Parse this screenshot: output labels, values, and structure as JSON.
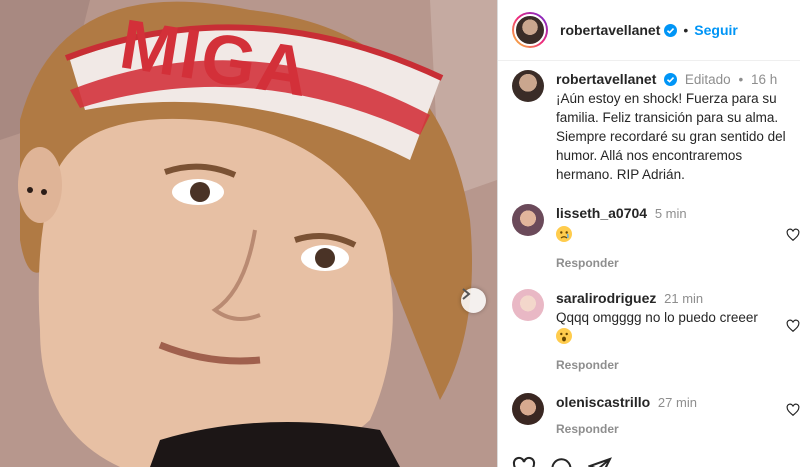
{
  "header": {
    "username": "robertavellanet",
    "follow_label": "Seguir",
    "separator": "•"
  },
  "caption": {
    "username": "robertavellanet",
    "edited": "Editado",
    "separator": "•",
    "time": "16 h",
    "text": "¡Aún estoy en shock! Fuerza para su familia. Feliz transición para su alma. Siempre recordaré su gran sentido del humor. Allá nos encontraremos hermano. RIP Adrián."
  },
  "photo": {
    "headband_text": "MIGA"
  },
  "comments": [
    {
      "username": "lisseth_a0704",
      "time": "5 min",
      "text": "",
      "emoji": "sad-face",
      "reply_label": "Responder"
    },
    {
      "username": "saralirodriguez",
      "time": "21 min",
      "text": "Qqqq omgggg no lo puedo creeer",
      "emoji": "surprised-face",
      "reply_label": "Responder"
    },
    {
      "username": "oleniscastrillo",
      "time": "27 min",
      "text": "",
      "emoji": "",
      "reply_label": "Responder"
    }
  ],
  "colors": {
    "accent": "#0095f6",
    "muted": "#8e8e8e",
    "text": "#262626"
  },
  "icons": [
    "chevron-right-icon",
    "verified-badge-icon",
    "heart-outline-icon",
    "like-icon",
    "comment-icon",
    "share-icon"
  ]
}
